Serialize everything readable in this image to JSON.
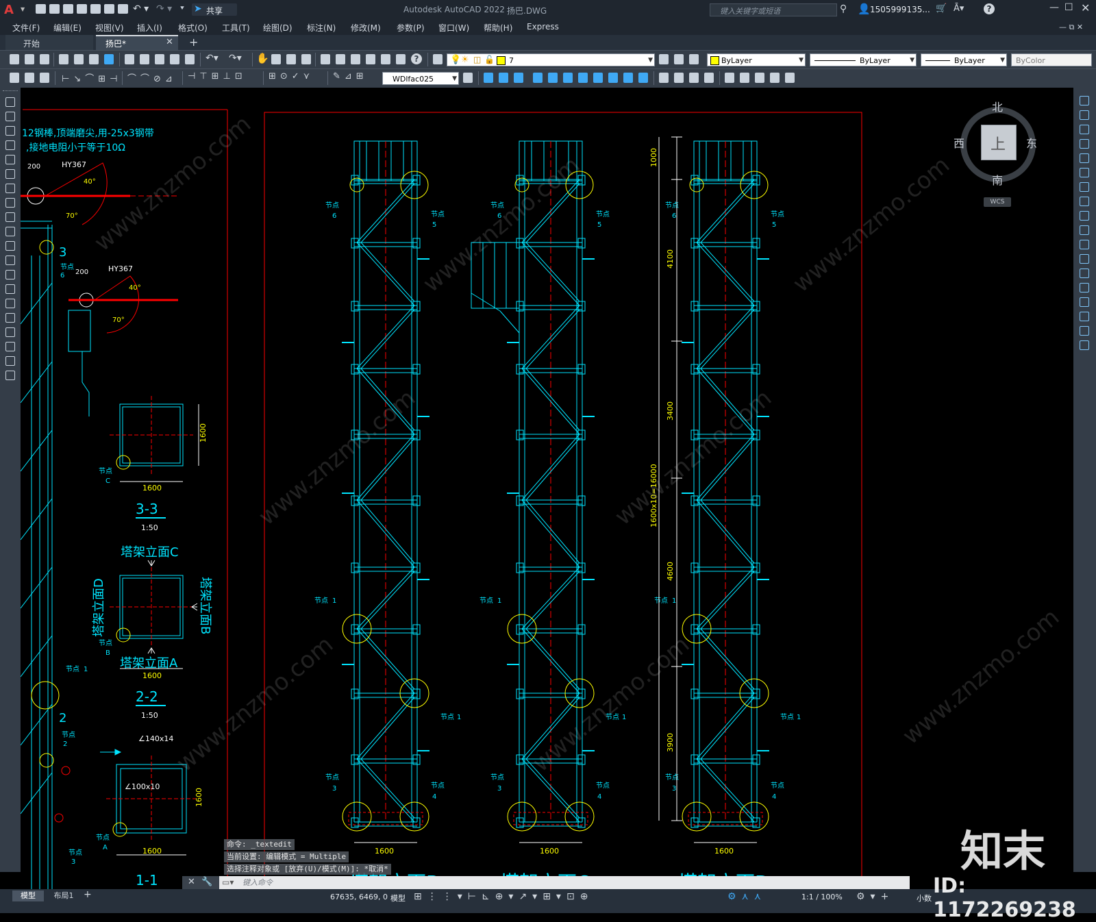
{
  "app": {
    "title": "Autodesk AutoCAD 2022",
    "filename": "扬巴.DWG",
    "search_placeholder": "键入关键字或短语",
    "user": "1505999135...",
    "share": "共享"
  },
  "menu": [
    "文件(F)",
    "编辑(E)",
    "视图(V)",
    "插入(I)",
    "格式(O)",
    "工具(T)",
    "绘图(D)",
    "标注(N)",
    "修改(M)",
    "参数(P)",
    "窗口(W)",
    "帮助(H)",
    "Express"
  ],
  "tabs": [
    {
      "label": "开始"
    },
    {
      "label": "扬巴*"
    }
  ],
  "layer": {
    "current": "7",
    "color_label": "ByLayer",
    "linetype": "ByLayer",
    "lineweight": "ByLayer",
    "plotstyle": "ByColor"
  },
  "text_style": "WDlfac025",
  "colors": {
    "bg": "#000000",
    "cyan": "#00e5ff",
    "yellow": "#ffff00",
    "red": "#ff0000",
    "white": "#ffffff"
  },
  "viewcube": {
    "n": "北",
    "s": "南",
    "e": "东",
    "w": "西",
    "top": "上",
    "wcs": "WCS"
  },
  "drawing": {
    "note_line1": "12钢棒,顶端磨尖,用-25x3钢带",
    "note_line2": ",接地电阻小于等于10Ω",
    "hy_label": "HY367",
    "dim_200": "200",
    "angle_40": "40°",
    "angle_70": "70°",
    "section_3": "3",
    "section_2": "2",
    "sec33_title": "3-3",
    "sec33_scale": "1:50",
    "sec22_title": "2-2",
    "sec22_scale": "1:50",
    "sec11_title": "1-1",
    "dim_1600": "1600",
    "elev_c": "塔架立面C",
    "elev_a": "塔架立面A",
    "elev_b": "塔架立面B",
    "elev_d": "塔架立面D",
    "angle_140": "∠140x14",
    "angle_100": "∠100x10",
    "node": "节点",
    "node_c": "C",
    "node_b": "B",
    "node_a": "A",
    "n1": "1",
    "n2": "2",
    "n3": "3",
    "n4": "4",
    "n5": "5",
    "n6": "6",
    "dim_1000": "1000",
    "dim_4100": "4100",
    "dim_3400": "3400",
    "dim_4600": "4600",
    "dim_3900": "3900",
    "dim_total": "1600x10=16000",
    "bottom_titles": [
      "塔架立面B",
      "塔架立面C",
      "塔架立面D"
    ]
  },
  "command": {
    "hist1": "命令: _textedit",
    "hist2": "当前设置: 编辑模式 = Multiple",
    "hist3": "选择注释对象或 [放弃(U)/模式(M)]: *取消*",
    "placeholder": "键入命令"
  },
  "status": {
    "layout_tabs": [
      "模型",
      "布局1"
    ],
    "coords": "67635, 6469, 0",
    "model": "模型",
    "scale": "1:1 / 100%",
    "units": "小数"
  },
  "watermark": {
    "brand": "知末",
    "id": "ID: 1172269238",
    "site": "www.znzmo.com"
  }
}
